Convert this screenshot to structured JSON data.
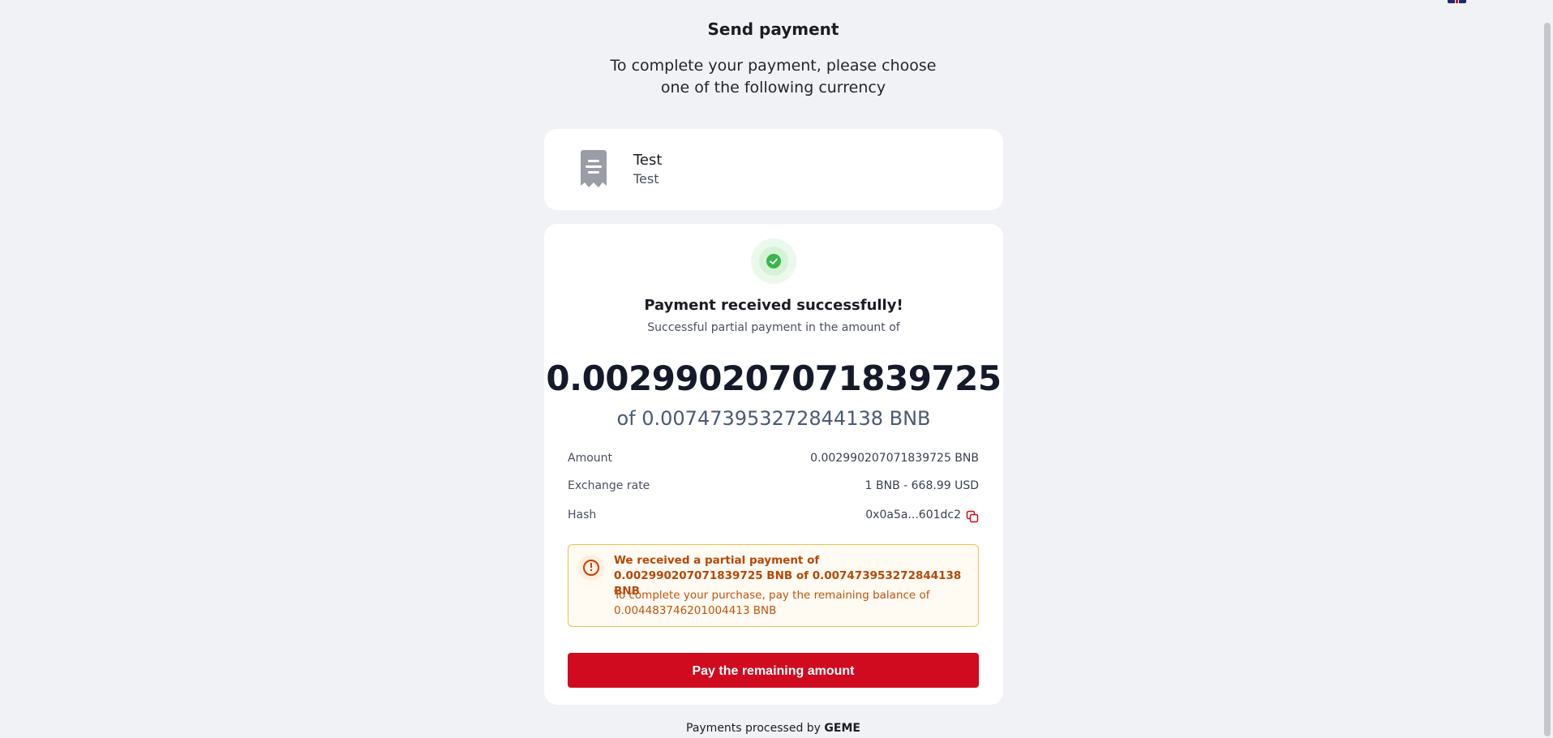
{
  "header": {
    "title": "Send payment",
    "subtitle_line1": "To complete your payment, please choose",
    "subtitle_line2": "one of the following currency",
    "language_flag": "uk-flag-icon"
  },
  "merchant": {
    "icon": "receipt-icon",
    "name": "Test",
    "description": "Test"
  },
  "status": {
    "icon": "success-check-icon",
    "title": "Payment received successfully!",
    "subtitle": "Successful partial payment in the amount of",
    "received_amount": "0.002990207071839725",
    "total_amount": "of 0.007473953272844138 BNB"
  },
  "details": {
    "amount_label": "Amount",
    "amount_value": "0.002990207071839725 BNB",
    "rate_label": "Exchange rate",
    "rate_value": "1 BNB - 668.99 USD",
    "hash_label": "Hash",
    "hash_value": "0x0a5a...601dc2",
    "copy_icon": "copy-icon"
  },
  "warning": {
    "icon": "alert-circle-icon",
    "title": "We received a partial payment of 0.002990207071839725 BNB of 0.007473953272844138 BNB",
    "text": "To complete your purchase, pay the remaining balance of 0.004483746201004413 BNB"
  },
  "actions": {
    "pay_remaining_label": "Pay the remaining amount"
  },
  "footer": {
    "prefix": "Payments processed by",
    "brand": "GEME"
  },
  "colors": {
    "accent": "#d00a1f",
    "success": "#3ab54a",
    "warning": "#b54708",
    "background": "#f1f2f6"
  }
}
